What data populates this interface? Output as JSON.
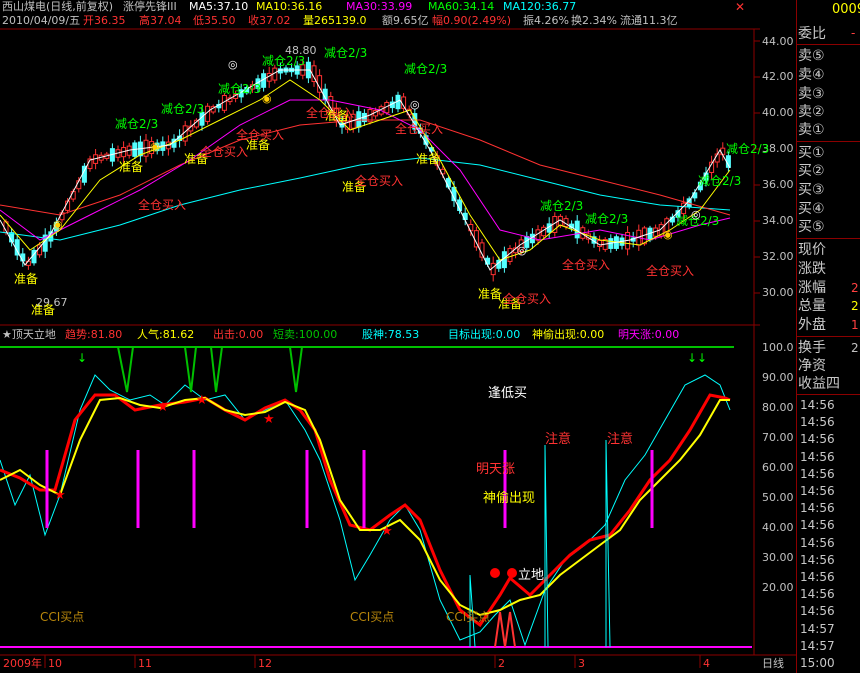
{
  "header": {
    "title": "西山煤电(日线,前复权)",
    "indicator": "涨停先锋III",
    "ma5": "MA5:37.10",
    "ma10": "MA10:36.16",
    "ma30": "MA30:33.99",
    "ma60": "MA60:34.14",
    "ma120": "MA120:36.77",
    "code": "0009",
    "info_date": "2010/04/09/五",
    "open": "开36.35",
    "high": "高37.04",
    "low": "低35.50",
    "close": "收37.02",
    "volume": "量265139.0",
    "amount": "额9.65亿",
    "change": "幅0.90(2.49%)",
    "amplitude": "振4.26%",
    "turnover": "换2.34%",
    "float": "流通11.3亿"
  },
  "price_axis": {
    "labels": [
      "44.00",
      "42.00",
      "40.00",
      "38.00",
      "36.00",
      "34.00",
      "32.00",
      "30.00"
    ]
  },
  "price_annotations": {
    "high_mark": "48.80",
    "low_mark": "29.67",
    "reduce": "减仓2/3",
    "ready": "准备",
    "full_buy": "全仓买入"
  },
  "indicator_header": {
    "name": "★顶天立地",
    "trend": "趋势:81.80",
    "popularity": "人气:81.62",
    "exit": "出击:0.00",
    "short": "短卖:100.00",
    "stock_god": "股神:78.53",
    "target": "目标出现:0.00",
    "god_steal": "神偷出现:0.00",
    "tomorrow_up": "明天涨:0.00"
  },
  "indicator_axis": {
    "labels": [
      "100.0",
      "90.00",
      "80.00",
      "70.00",
      "60.00",
      "50.00",
      "40.00",
      "30.00",
      "20.00"
    ]
  },
  "indicator_annotations": {
    "low_buy": "逢低买",
    "tomorrow": "明天涨",
    "god_steal": "神偷出现",
    "attention": "注意",
    "standing": "立地",
    "cci_buy": "CCI买点"
  },
  "time_axis": {
    "labels": [
      "2009年",
      "10",
      "11",
      "12",
      "2",
      "3",
      "4"
    ],
    "period": "日线"
  },
  "right_panel": {
    "commission": "委比",
    "sells": [
      "卖⑤",
      "卖④",
      "卖③",
      "卖②",
      "卖①"
    ],
    "buys": [
      "买①",
      "买②",
      "买③",
      "买④",
      "买⑤"
    ],
    "stats": [
      "现价",
      "涨跌",
      "涨幅",
      "总量",
      "外盘",
      "换手",
      "净资",
      "收益四"
    ],
    "stat_values": [
      "",
      "",
      "2",
      "2",
      "1",
      "2",
      "",
      ""
    ],
    "commission_value": "-",
    "times": [
      "14:56",
      "14:56",
      "14:56",
      "14:56",
      "14:56",
      "14:56",
      "14:56",
      "14:56",
      "14:56",
      "14:56",
      "14:56",
      "14:56",
      "14:56",
      "14:57",
      "14:57",
      "15:00"
    ]
  },
  "colors": {
    "up": "#ff3232",
    "down": "#54ffff",
    "ma5": "#ffffff",
    "ma10": "#ffff00",
    "ma30": "#ff00ff",
    "ma60": "#00ff00",
    "ma120": "#00ffff"
  }
}
